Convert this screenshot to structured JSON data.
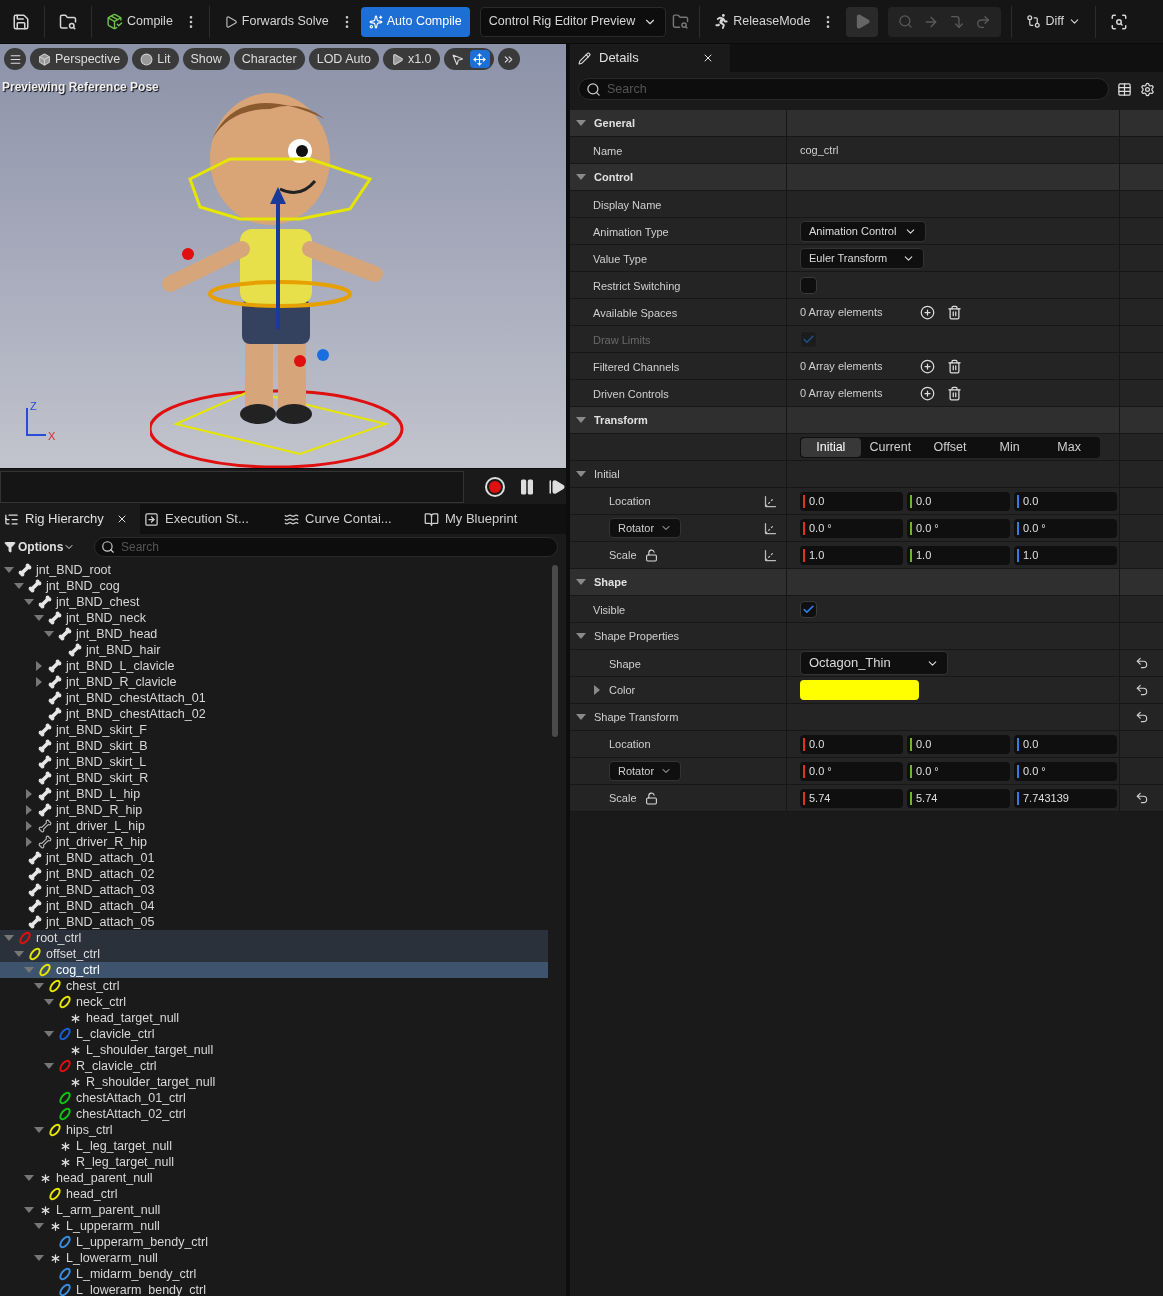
{
  "toolbar": {
    "compile": {
      "label": "Compile"
    },
    "forwards_solve": {
      "label": "Forwards Solve"
    },
    "auto_compile": {
      "label": "Auto Compile",
      "on": true
    },
    "preview": {
      "label": "Control Rig Editor Preview"
    },
    "release_mode": {
      "label": "ReleaseMode"
    },
    "diff": {
      "label": "Diff"
    }
  },
  "viewport": {
    "buttons": [
      {
        "label": "Perspective"
      },
      {
        "label": "Lit"
      },
      {
        "label": "Show"
      },
      {
        "label": "Character"
      },
      {
        "label": "LOD Auto"
      },
      {
        "label": "x1.0"
      }
    ],
    "tools": [
      {
        "selected": false
      },
      {
        "selected": true
      }
    ],
    "status": "Previewing Reference Pose",
    "axis": {
      "vertical": "Z",
      "horizontal": "X"
    }
  },
  "hierarchy": {
    "tabs": [
      {
        "label": "Rig Hierarchy",
        "selected": true
      },
      {
        "label": "Execution St...",
        "selected": false
      },
      {
        "label": "Curve Contai...",
        "selected": false
      },
      {
        "label": "My Blueprint",
        "selected": false
      }
    ],
    "options": "Options",
    "search_placeholder": "Search",
    "tree": [
      {
        "name": "jnt_BND_root",
        "kind": "bone",
        "expanded": true,
        "selected": false,
        "children": [
          {
            "name": "jnt_BND_cog",
            "kind": "bone",
            "expanded": true,
            "selected": false,
            "children": [
              {
                "name": "jnt_BND_chest",
                "kind": "bone",
                "expanded": true,
                "selected": false,
                "children": [
                  {
                    "name": "jnt_BND_neck",
                    "kind": "bone",
                    "expanded": true,
                    "selected": false,
                    "children": [
                      {
                        "name": "jnt_BND_head",
                        "kind": "bone",
                        "expanded": true,
                        "selected": false,
                        "children": [
                          {
                            "name": "jnt_BND_hair",
                            "kind": "bone",
                            "selected": false
                          }
                        ]
                      }
                    ]
                  },
                  {
                    "name": "jnt_BND_L_clavicle",
                    "kind": "bone",
                    "expanded": false,
                    "selected": false
                  },
                  {
                    "name": "jnt_BND_R_clavicle",
                    "kind": "bone",
                    "expanded": false,
                    "selected": false
                  },
                  {
                    "name": "jnt_BND_chestAttach_01",
                    "kind": "bone",
                    "selected": false
                  },
                  {
                    "name": "jnt_BND_chestAttach_02",
                    "kind": "bone",
                    "selected": false
                  }
                ]
              },
              {
                "name": "jnt_BND_skirt_F",
                "kind": "bone",
                "selected": false
              },
              {
                "name": "jnt_BND_skirt_B",
                "kind": "bone",
                "selected": false
              },
              {
                "name": "jnt_BND_skirt_L",
                "kind": "bone",
                "selected": false
              },
              {
                "name": "jnt_BND_skirt_R",
                "kind": "bone",
                "selected": false
              },
              {
                "name": "jnt_BND_L_hip",
                "kind": "bone",
                "expanded": false,
                "selected": false
              },
              {
                "name": "jnt_BND_R_hip",
                "kind": "bone",
                "expanded": false,
                "selected": false
              },
              {
                "name": "jnt_driver_L_hip",
                "kind": "driver",
                "expanded": false,
                "selected": false
              },
              {
                "name": "jnt_driver_R_hip",
                "kind": "driver",
                "expanded": false,
                "selected": false
              }
            ]
          },
          {
            "name": "jnt_BND_attach_01",
            "kind": "bone",
            "selected": false
          },
          {
            "name": "jnt_BND_attach_02",
            "kind": "bone",
            "selected": false
          },
          {
            "name": "jnt_BND_attach_03",
            "kind": "bone",
            "selected": false
          },
          {
            "name": "jnt_BND_attach_04",
            "kind": "bone",
            "selected": false
          },
          {
            "name": "jnt_BND_attach_05",
            "kind": "bone",
            "selected": false
          }
        ]
      },
      {
        "name": "root_ctrl",
        "kind": "control",
        "color": "#e01010",
        "expanded": true,
        "selected": false,
        "children": [
          {
            "name": "offset_ctrl",
            "kind": "control",
            "color": "#e6e600",
            "expanded": true,
            "selected": false,
            "children": [
              {
                "name": "cog_ctrl",
                "kind": "control",
                "color": "#e6e600",
                "expanded": true,
                "selected": true,
                "children": [
                  {
                    "name": "chest_ctrl",
                    "kind": "control",
                    "color": "#e6e600",
                    "expanded": true,
                    "selected": false,
                    "children": [
                      {
                        "name": "neck_ctrl",
                        "kind": "control",
                        "color": "#e6e600",
                        "expanded": true,
                        "selected": false,
                        "children": [
                          {
                            "name": "head_target_null",
                            "kind": "null",
                            "selected": false
                          }
                        ]
                      },
                      {
                        "name": "L_clavicle_ctrl",
                        "kind": "control",
                        "color": "#1a5fd6",
                        "expanded": true,
                        "selected": false,
                        "children": [
                          {
                            "name": "L_shoulder_target_null",
                            "kind": "null",
                            "selected": false
                          }
                        ]
                      },
                      {
                        "name": "R_clavicle_ctrl",
                        "kind": "control",
                        "color": "#e01010",
                        "expanded": true,
                        "selected": false,
                        "children": [
                          {
                            "name": "R_shoulder_target_null",
                            "kind": "null",
                            "selected": false
                          }
                        ]
                      },
                      {
                        "name": "chestAttach_01_ctrl",
                        "kind": "control",
                        "color": "#12c412",
                        "selected": false
                      },
                      {
                        "name": "chestAttach_02_ctrl",
                        "kind": "control",
                        "color": "#12c412",
                        "selected": false
                      }
                    ]
                  },
                  {
                    "name": "hips_ctrl",
                    "kind": "control",
                    "color": "#e6e600",
                    "expanded": true,
                    "selected": false,
                    "children": [
                      {
                        "name": "L_leg_target_null",
                        "kind": "null",
                        "selected": false
                      },
                      {
                        "name": "R_leg_target_null",
                        "kind": "null",
                        "selected": false
                      }
                    ]
                  }
                ]
              },
              {
                "name": "head_parent_null",
                "kind": "null",
                "expanded": true,
                "selected": false,
                "children": [
                  {
                    "name": "head_ctrl",
                    "kind": "control",
                    "color": "#e6e600",
                    "selected": false
                  }
                ]
              },
              {
                "name": "L_arm_parent_null",
                "kind": "null",
                "expanded": true,
                "selected": false,
                "children": [
                  {
                    "name": "L_upperarm_null",
                    "kind": "null",
                    "expanded": true,
                    "selected": false,
                    "children": [
                      {
                        "name": "L_upperarm_bendy_ctrl",
                        "kind": "control",
                        "color": "#3a8ee0",
                        "selected": false
                      }
                    ]
                  },
                  {
                    "name": "L_lowerarm_null",
                    "kind": "null",
                    "expanded": true,
                    "selected": false,
                    "children": [
                      {
                        "name": "L_midarm_bendy_ctrl",
                        "kind": "control",
                        "color": "#3a8ee0",
                        "selected": false
                      },
                      {
                        "name": "L_lowerarm_bendy_ctrl",
                        "kind": "control",
                        "color": "#3a8ee0",
                        "selected": false
                      }
                    ]
                  }
                ]
              }
            ]
          }
        ]
      }
    ]
  },
  "details": {
    "tab": "Details",
    "search_placeholder": "Search",
    "rows": [
      {
        "kind": "section",
        "label": "General",
        "expanded": true
      },
      {
        "kind": "text",
        "label": "Name",
        "value": "cog_ctrl"
      },
      {
        "kind": "section",
        "label": "Control",
        "expanded": true
      },
      {
        "kind": "text",
        "label": "Display Name"
      },
      {
        "kind": "dropdown",
        "label": "Animation Type",
        "value": "Animation Control",
        "wide": false,
        "reset": false
      },
      {
        "kind": "dropdown",
        "label": "Value Type",
        "value": "Euler Transform",
        "wide": false,
        "reset": false
      },
      {
        "kind": "checkbox",
        "label": "Restrict Switching",
        "checked": false,
        "disabled": false
      },
      {
        "kind": "array",
        "label": "Available Spaces",
        "value": "0 Array elements"
      },
      {
        "kind": "checkbox",
        "label": "Draw Limits",
        "checked": true,
        "disabled": true
      },
      {
        "kind": "array",
        "label": "Filtered Channels",
        "value": "0 Array elements"
      },
      {
        "kind": "array",
        "label": "Driven Controls",
        "value": "0 Array elements"
      },
      {
        "kind": "section",
        "label": "Transform",
        "expanded": true
      },
      {
        "kind": "tabs",
        "tabs": [
          {
            "label": "Initial",
            "selected": true
          },
          {
            "label": "Current",
            "selected": false
          },
          {
            "label": "Offset",
            "selected": false
          },
          {
            "label": "Min",
            "selected": false
          },
          {
            "label": "Max",
            "selected": false
          }
        ]
      },
      {
        "kind": "group",
        "label": "Initial",
        "expanded": true,
        "reset": false,
        "children": [
          {
            "kind": "vector",
            "label": "Location",
            "label_dropdown": false,
            "lock": false,
            "space_toggle": true,
            "reset": false,
            "values": [
              "0.0",
              "0.0",
              "0.0"
            ]
          },
          {
            "kind": "vector",
            "label": "Rotator",
            "label_dropdown": true,
            "lock": false,
            "space_toggle": true,
            "reset": false,
            "values": [
              "0.0 °",
              "0.0 °",
              "0.0 °"
            ]
          },
          {
            "kind": "vector",
            "label": "Scale",
            "label_dropdown": false,
            "lock": true,
            "space_toggle": true,
            "reset": false,
            "values": [
              "1.0",
              "1.0",
              "1.0"
            ]
          }
        ]
      },
      {
        "kind": "section",
        "label": "Shape",
        "expanded": true
      },
      {
        "kind": "checkbox",
        "label": "Visible",
        "checked": true,
        "disabled": false
      },
      {
        "kind": "group",
        "label": "Shape Properties",
        "expanded": true,
        "reset": false,
        "children": [
          {
            "kind": "dropdown",
            "label": "Shape",
            "value": "Octagon_Thin",
            "wide": true,
            "reset": true
          },
          {
            "kind": "color",
            "label": "Color",
            "color": "#ffff00",
            "expanded": false,
            "reset": true
          }
        ]
      },
      {
        "kind": "group",
        "label": "Shape Transform",
        "expanded": true,
        "reset": true,
        "children": [
          {
            "kind": "vector",
            "label": "Location",
            "label_dropdown": false,
            "lock": false,
            "space_toggle": false,
            "reset": false,
            "values": [
              "0.0",
              "0.0",
              "0.0"
            ]
          },
          {
            "kind": "vector",
            "label": "Rotator",
            "label_dropdown": true,
            "lock": false,
            "space_toggle": false,
            "reset": false,
            "values": [
              "0.0 °",
              "0.0 °",
              "0.0 °"
            ]
          },
          {
            "kind": "vector",
            "label": "Scale",
            "label_dropdown": false,
            "lock": true,
            "space_toggle": false,
            "reset": true,
            "values": [
              "5.74",
              "5.74",
              "7.743139"
            ]
          }
        ]
      }
    ]
  }
}
